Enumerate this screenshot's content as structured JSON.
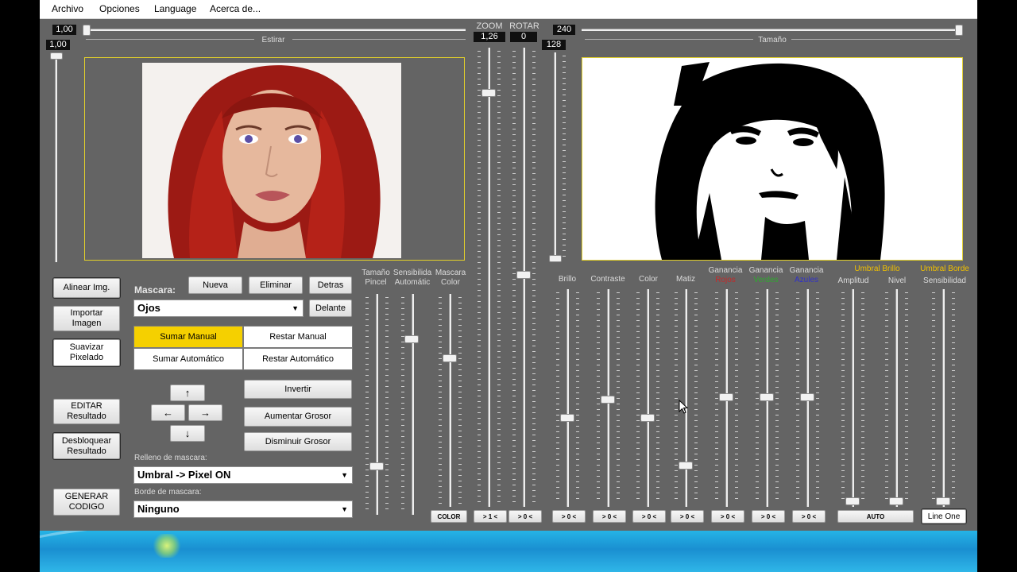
{
  "menu": [
    "Archivo",
    "Opciones",
    "Language",
    "Acerca de..."
  ],
  "top": {
    "estirar_value": "1,00",
    "estirar_label": "Estirar",
    "vert_value": "1,00",
    "zoom_label": "ZOOM",
    "rotar_label": "ROTAR",
    "zoom_value": "1,26",
    "rotar_value": "0",
    "tamano_value": "240",
    "umbral_value": "128",
    "tamano_label": "Tamaño"
  },
  "left_buttons": {
    "alinear": "Alinear Img.",
    "importar_1": "Importar",
    "importar_2": "Imagen",
    "suavizar_1": "Suavizar",
    "suavizar_2": "Pixelado",
    "editar_1": "EDITAR",
    "editar_2": "Resultado",
    "desbloquear_1": "Desbloquear",
    "desbloquear_2": "Resultado",
    "generar_1": "GENERAR",
    "generar_2": "CODIGO"
  },
  "mask": {
    "label": "Mascara:",
    "nueva": "Nueva",
    "eliminar": "Eliminar",
    "detras": "Detras",
    "delante": "Delante",
    "selected": "Ojos",
    "sumar_manual": "Sumar Manual",
    "restar_manual": "Restar Manual",
    "sumar_auto": "Sumar Automático",
    "restar_auto": "Restar Automático",
    "invertir": "Invertir",
    "aumentar": "Aumentar Grosor",
    "disminuir": "Disminuir Grosor",
    "relleno_label": "Relleno de mascara:",
    "relleno_value": "Umbral -> Pixel ON",
    "borde_label": "Borde de mascara:",
    "borde_value": "Ninguno"
  },
  "arrows": {
    "up": "↑",
    "left": "←",
    "right": "→",
    "down": "↓"
  },
  "brush": {
    "tamano_1": "Tamaño",
    "tamano_2": "Pincel",
    "sens_1": "Sensibilida",
    "sens_2": "Automátic",
    "mcolor_1": "Mascara",
    "mcolor_2": "Color",
    "color_btn": "COLOR"
  },
  "adjust": {
    "brillo": "Brillo",
    "contraste": "Contraste",
    "color": "Color",
    "matiz": "Matiz",
    "ganancia": "Ganancia",
    "rojos": "Rojos",
    "verdes": "Verdes",
    "azules": "Azules",
    "umbral_brillo": "Umbral Brillo",
    "amplitud": "Amplitud",
    "nivel": "Nivel",
    "umbral_borde": "Umbral Borde",
    "sensibilidad": "Sensibilidad",
    "reset_zoom": "> 1 <",
    "reset": "> 0 <",
    "auto": "AUTO",
    "line_one": "Line One"
  },
  "colors": {
    "app_bg": "#646464",
    "frame": "#e3d02a",
    "active_seg": "#f5d000",
    "rojos": "#c22a2a",
    "verdes": "#2faa2f",
    "azules": "#3030c8",
    "umbral_text": "#f0c000"
  }
}
